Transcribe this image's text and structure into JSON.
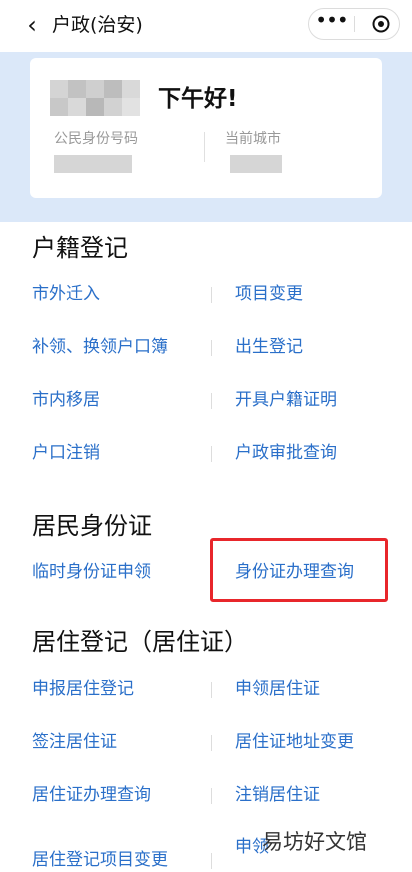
{
  "header": {
    "back_glyph": "‹",
    "title": "户政(治安)",
    "more_glyph": "•••",
    "close_icon": "capsule-close-icon"
  },
  "user_card": {
    "greeting": "下午好!",
    "id_label": "公民身份号码",
    "city_label": "当前城市"
  },
  "sections": [
    {
      "title": "户籍登记",
      "items": [
        "市外迁入",
        "项目变更",
        "补领、换领户口簿",
        "出生登记",
        "市内移居",
        "开具户籍证明",
        "户口注销",
        "户政审批查询"
      ]
    },
    {
      "title": "居民身份证",
      "items": [
        "临时身份证申领",
        "身份证办理查询"
      ]
    },
    {
      "title": "居住登记（居住证）",
      "items": [
        "申报居住登记",
        "申领居住证",
        "签注居住证",
        "居住证地址变更",
        "居住证办理查询",
        "注销居住证",
        "居住登记项目变更",
        "申领"
      ]
    }
  ],
  "watermark": "易坊好文馆",
  "colors": {
    "link": "#2a6fc9",
    "band": "#dbe8f9",
    "highlight": "#e8262b"
  }
}
